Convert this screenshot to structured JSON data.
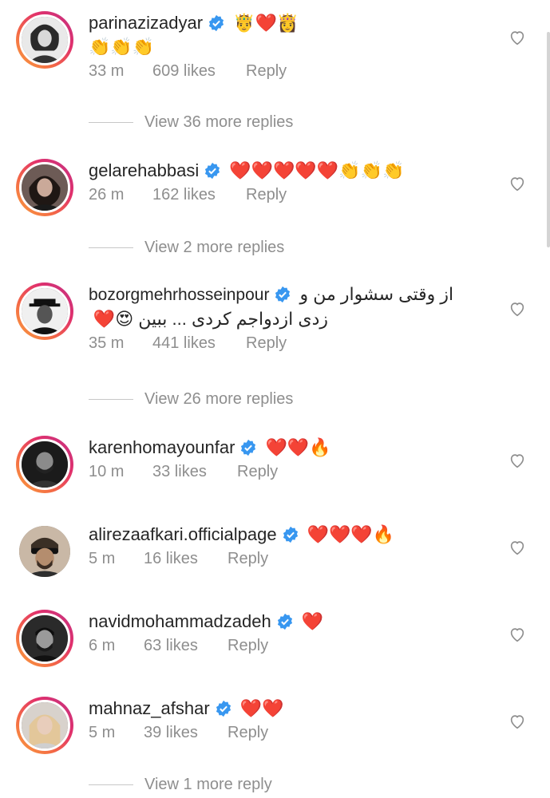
{
  "comments": [
    {
      "username": "parinazizadyar",
      "text": "🤴❤️👸",
      "text2": "👏👏👏",
      "time": "33 m",
      "likes": "609 likes",
      "reply": "Reply"
    },
    {
      "username": "gelarehabbasi",
      "text": "❤️❤️❤️❤️❤️👏👏👏",
      "time": "26 m",
      "likes": "162 likes",
      "reply": "Reply"
    },
    {
      "username": "bozorgmehrhosseinpour",
      "text": "از وقتی سشوار من و",
      "text2": "زدی ازدواجم کردی ... ببین 😍❤️",
      "time": "35 m",
      "likes": "441 likes",
      "reply": "Reply"
    },
    {
      "username": "karenhomayounfar",
      "text": "❤️❤️🔥",
      "time": "10 m",
      "likes": "33 likes",
      "reply": "Reply"
    },
    {
      "username": "alirezaafkari.officialpage",
      "text": "❤️❤️❤️🔥",
      "time": "5 m",
      "likes": "16 likes",
      "reply": "Reply"
    },
    {
      "username": "navidmohammadzadeh",
      "text": "❤️",
      "time": "6 m",
      "likes": "63 likes",
      "reply": "Reply"
    },
    {
      "username": "mahnaz_afshar",
      "text": "❤️❤️",
      "time": "5 m",
      "likes": "39 likes",
      "reply": "Reply"
    }
  ],
  "view_more": [
    "View 36 more replies",
    "View 2 more replies",
    "View 26 more replies",
    "View 1 more reply"
  ],
  "icons": {
    "verified": "verified-badge-icon",
    "like": "heart-outline-icon"
  },
  "colors": {
    "verified": "#3897f0",
    "meta": "#8e8e8e",
    "ring_start": "#f9a03f",
    "ring_end": "#c13584"
  }
}
